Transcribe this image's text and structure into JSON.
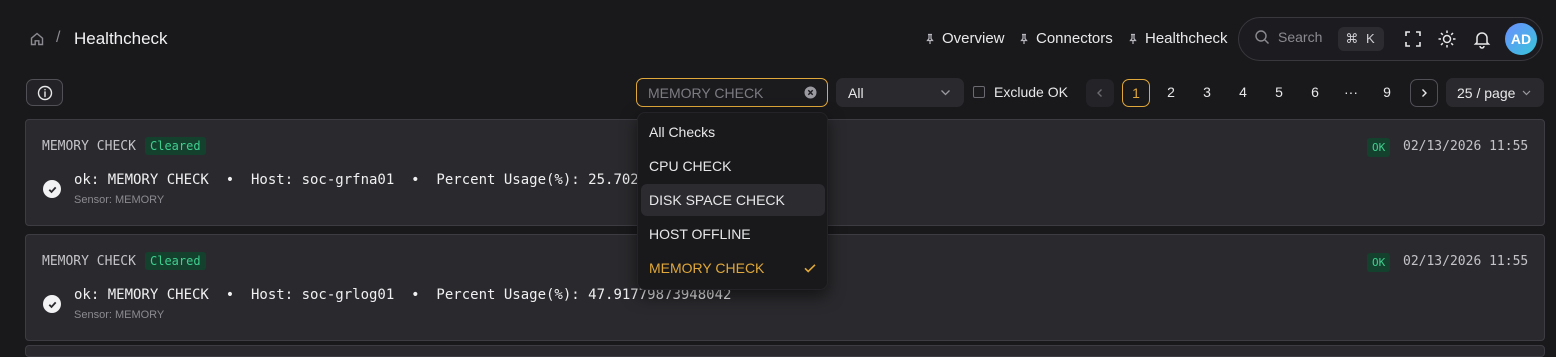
{
  "breadcrumb": {
    "title": "Healthcheck"
  },
  "nav": [
    {
      "label": "Overview"
    },
    {
      "label": "Connectors"
    },
    {
      "label": "Healthcheck"
    }
  ],
  "search": {
    "placeholder": "Search",
    "shortcut": "⌘ K"
  },
  "user": {
    "initials": "AD"
  },
  "filters": {
    "check_placeholder": "MEMORY CHECK",
    "status_value": "All",
    "exclude_ok_label": "Exclude OK",
    "exclude_ok_checked": false
  },
  "pagination": {
    "pages": [
      "1",
      "2",
      "3",
      "4",
      "5",
      "6",
      "···",
      "9"
    ],
    "active": "1",
    "per_page": "25 / page"
  },
  "dropdown": {
    "options": [
      {
        "label": "All Checks"
      },
      {
        "label": "CPU CHECK"
      },
      {
        "label": "DISK SPACE CHECK"
      },
      {
        "label": "HOST OFFLINE"
      },
      {
        "label": "MEMORY CHECK"
      }
    ],
    "hovered": "DISK SPACE CHECK",
    "selected": "MEMORY CHECK"
  },
  "results": [
    {
      "title": "MEMORY CHECK",
      "badge": "Cleared",
      "status": "OK",
      "time": "02/13/2026 11:55",
      "message": "ok: MEMORY CHECK  •  Host: soc-grfna01  •  Percent Usage(%): 25.70241",
      "sensor": "Sensor: MEMORY"
    },
    {
      "title": "MEMORY CHECK",
      "badge": "Cleared",
      "status": "OK",
      "time": "02/13/2026 11:55",
      "message": "ok: MEMORY CHECK  •  Host: soc-grlog01  •  Percent Usage(%): 47.91779873948042",
      "sensor": "Sensor: MEMORY"
    }
  ],
  "colors": {
    "accent": "#e0a83a",
    "ok": "#3fcf8e",
    "background": "#19191c",
    "card": "#2a2a2e"
  }
}
